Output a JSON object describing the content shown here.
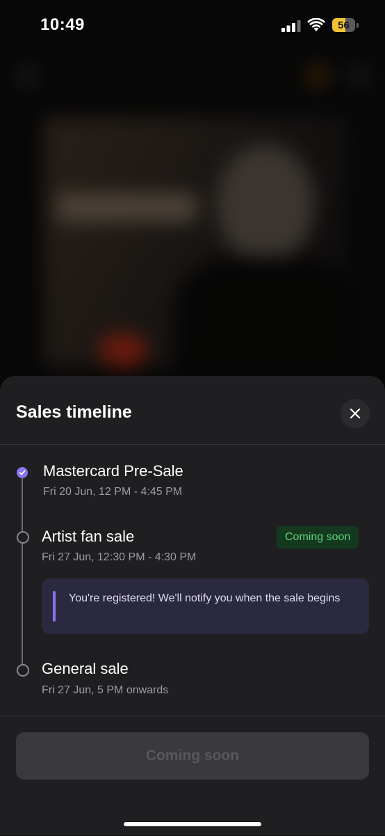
{
  "status_bar": {
    "time": "10:49",
    "battery_level": "56",
    "battery_color": "#f2c230"
  },
  "sheet": {
    "title": "Sales timeline",
    "close_icon": "close-icon",
    "events": [
      {
        "title": "Mastercard Pre-Sale",
        "date": "Fri 20 Jun, 12 PM - 4:45 PM",
        "status": "completed"
      },
      {
        "title": "Artist fan sale",
        "date": "Fri 27 Jun, 12:30 PM - 4:30 PM",
        "badge": "Coming soon",
        "notice": "You're registered! We'll notify you when the sale begins"
      },
      {
        "title": "General sale",
        "date": "Fri 27 Jun, 5 PM onwards"
      }
    ],
    "footer_button": "Coming soon"
  },
  "colors": {
    "accent": "#8b73f0",
    "badge_bg": "#15391f",
    "badge_text": "#5fd37c",
    "sheet_bg": "#1f1f21"
  }
}
